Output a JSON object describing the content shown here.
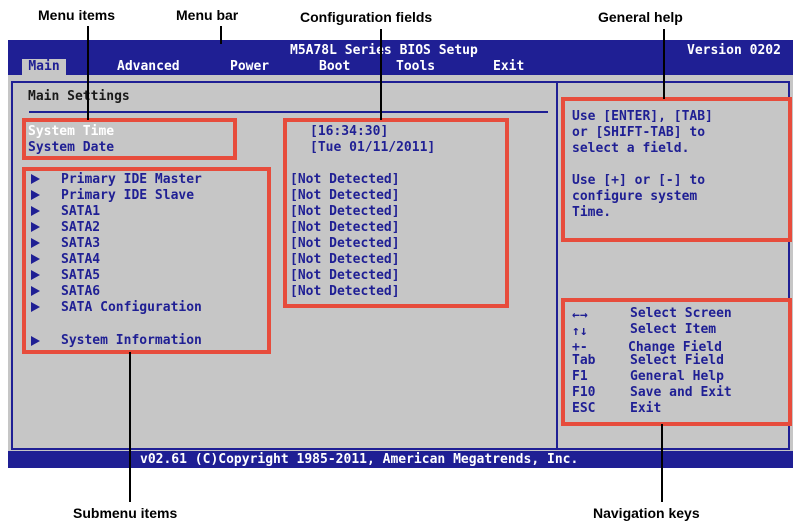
{
  "callouts": {
    "menu_items": "Menu items",
    "menu_bar": "Menu bar",
    "config_fields": "Configuration fields",
    "general_help": "General help",
    "submenu_items": "Submenu items",
    "navigation_keys": "Navigation keys"
  },
  "bios": {
    "title": "M5A78L Series BIOS Setup",
    "version": "Version 0202",
    "menus": [
      "Main",
      "Advanced",
      "Power",
      "Boot",
      "Tools",
      "Exit"
    ],
    "section_title": "Main Settings",
    "system_time_label": "System Time",
    "system_date_label": "System Date",
    "system_time_value": "[16:34:30]",
    "system_date_value": "[Tue 01/11/2011]",
    "submenu_items": [
      "Primary IDE Master",
      "Primary IDE Slave",
      "SATA1",
      "SATA2",
      "SATA3",
      "SATA4",
      "SATA5",
      "SATA6",
      "SATA Configuration",
      "System Information"
    ],
    "submenu_values": [
      "[Not Detected]",
      "[Not Detected]",
      "[Not Detected]",
      "[Not Detected]",
      "[Not Detected]",
      "[Not Detected]",
      "[Not Detected]",
      "[Not Detected]"
    ],
    "help_lines": [
      "Use [ENTER], [TAB]",
      "or [SHIFT-TAB] to",
      "select a field.",
      "",
      "Use [+] or [-] to",
      "configure system",
      "Time."
    ],
    "nav_keys": [
      {
        "key": "←→",
        "action": "Select Screen"
      },
      {
        "key": "↑↓",
        "action": "Select Item"
      },
      {
        "key": "+-",
        "action": "Change Field"
      },
      {
        "key": "Tab",
        "action": "Select Field"
      },
      {
        "key": "F1",
        "action": "General Help"
      },
      {
        "key": "F10",
        "action": "Save and Exit"
      },
      {
        "key": "ESC",
        "action": "Exit"
      }
    ],
    "footer": "v02.61 (C)Copyright 1985-2011, American Megatrends, Inc."
  },
  "colors": {
    "bios_blue": "#1f1f94",
    "bios_gray": "#c6c6c6",
    "highlight_red": "#e74c3c"
  }
}
